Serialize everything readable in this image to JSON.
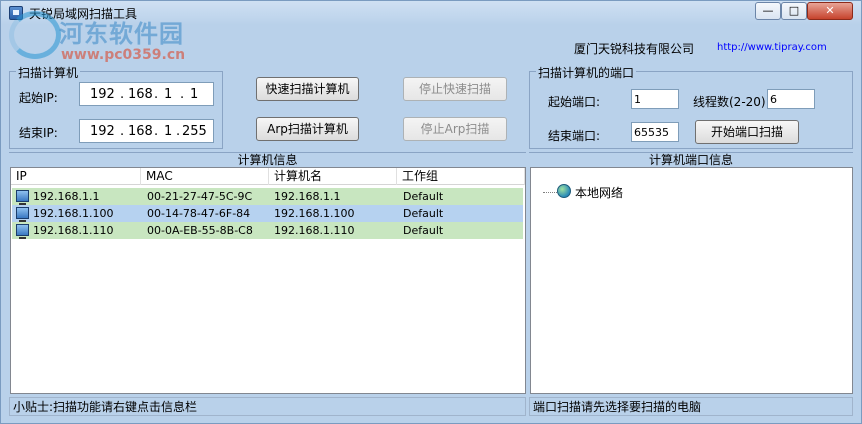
{
  "window": {
    "title": "天锐局域网扫描工具",
    "min_label": "—",
    "max_label": "□",
    "close_label": "✕"
  },
  "watermark": {
    "name": "河东软件园",
    "url": "www.pc0359.cn"
  },
  "company": {
    "name": "厦门天锐科技有限公司",
    "url": "http://www.tipray.com"
  },
  "scan_computers": {
    "title": "扫描计算机",
    "start_ip_label": "起始IP:",
    "end_ip_label": "结束IP:",
    "start_ip": [
      "192",
      "168",
      "1",
      "1"
    ],
    "end_ip": [
      "192",
      "168",
      "1",
      "255"
    ]
  },
  "buttons": {
    "quick_scan": "快速扫描计算机",
    "stop_quick_scan": "停止快速扫描",
    "arp_scan": "Arp扫描计算机",
    "stop_arp_scan": "停止Arp扫描",
    "start_port_scan": "开始端口扫描"
  },
  "port_scan": {
    "title": "扫描计算机的端口",
    "start_port_label": "起始端口:",
    "start_port": "1",
    "thread_label": "线程数(2-20):",
    "thread_count": "6",
    "end_port_label": "结束端口:",
    "end_port": "65535"
  },
  "computer_info": {
    "title": "计算机信息",
    "columns": [
      "IP",
      "MAC",
      "计算机名",
      "工作组"
    ],
    "rows": [
      {
        "ip": "192.168.1.1",
        "mac": "00-21-27-47-5C-9C",
        "name": "192.168.1.1",
        "group": "Default"
      },
      {
        "ip": "192.168.1.100",
        "mac": "00-14-78-47-6F-84",
        "name": "192.168.1.100",
        "group": "Default"
      },
      {
        "ip": "192.168.1.110",
        "mac": "00-0A-EB-55-8B-C8",
        "name": "192.168.1.110",
        "group": "Default"
      }
    ]
  },
  "port_info": {
    "title": "计算机端口信息",
    "tree_root": "本地网络"
  },
  "status": {
    "left": "小贴士:扫描功能请右键点击信息栏",
    "right": "端口扫描请先选择要扫描的电脑"
  }
}
